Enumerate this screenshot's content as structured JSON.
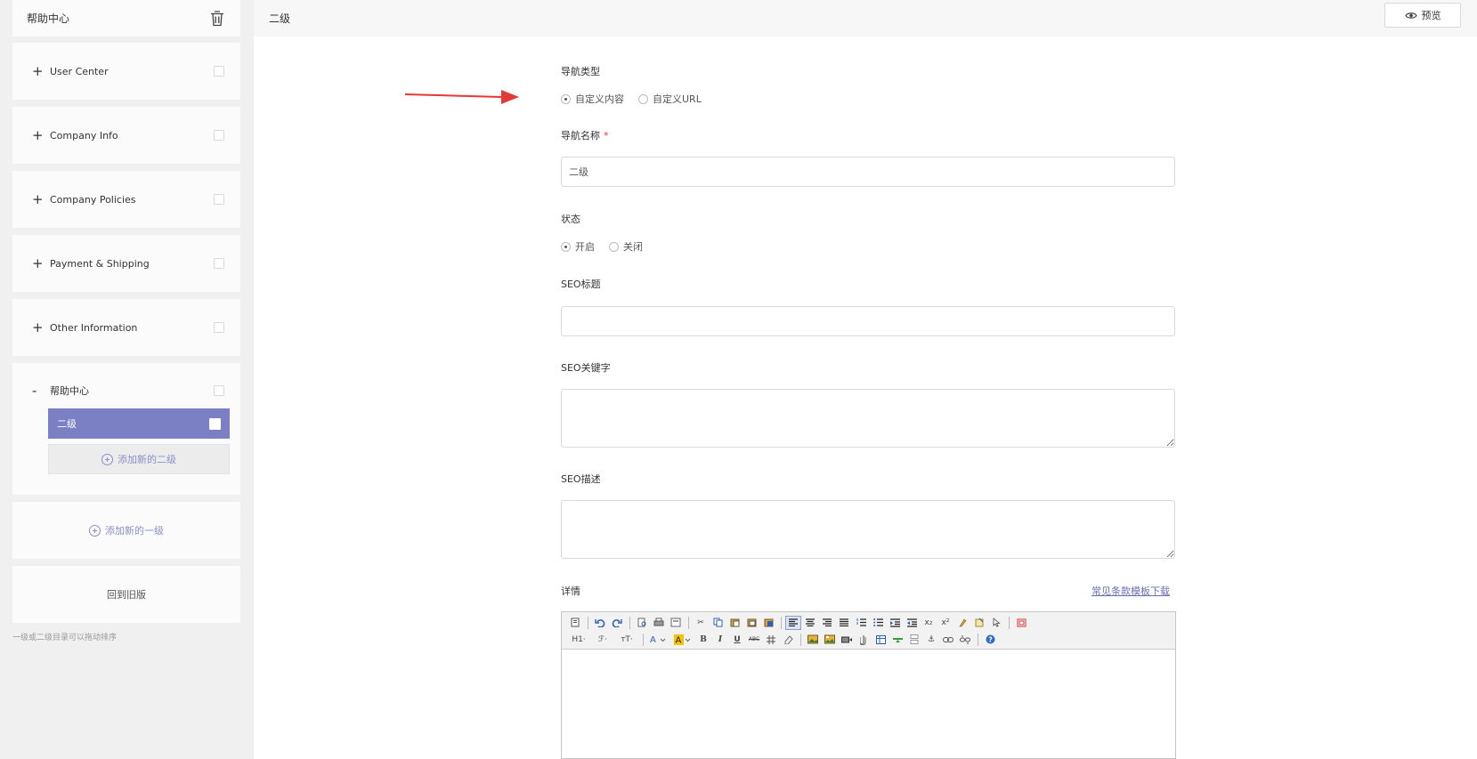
{
  "sidebar": {
    "header_title": "帮助中心",
    "items": [
      {
        "toggle": "+",
        "label": "User Center"
      },
      {
        "toggle": "+",
        "label": "Company Info"
      },
      {
        "toggle": "+",
        "label": "Company Policies"
      },
      {
        "toggle": "+",
        "label": "Payment & Shipping"
      },
      {
        "toggle": "+",
        "label": "Other Information"
      }
    ],
    "expanded": {
      "toggle": "-",
      "label": "帮助中心",
      "active_child": "二级",
      "add_child_label": "添加新的二级"
    },
    "add_top_label": "添加新的一级",
    "back_old_label": "回到旧版",
    "hint": "一级或二级目录可以拖动排序"
  },
  "topbar": {
    "title": "二级",
    "preview_label": "预览"
  },
  "form": {
    "nav_type_label": "导航类型",
    "nav_type_options": [
      "自定义内容",
      "自定义URL"
    ],
    "nav_type_selected": "自定义内容",
    "nav_name_label": "导航名称",
    "nav_name_required": "*",
    "nav_name_value": "二级",
    "status_label": "状态",
    "status_options": [
      "开启",
      "关闭"
    ],
    "status_selected": "开启",
    "seo_title_label": "SEO标题",
    "seo_title_value": "",
    "seo_keywords_label": "SEO关键字",
    "seo_desc_label": "SEO描述",
    "detail_label": "详情",
    "template_link": "常见条款模板下载"
  },
  "editor": {
    "row2_labels": {
      "heading": "H1·",
      "font": "ℱ·",
      "size": "тT·",
      "bold": "B",
      "italic": "I",
      "underline": "U",
      "strike": "ABC"
    }
  },
  "colors": {
    "accent": "#7b7fc4",
    "arrow": "#e53935",
    "link": "#6a6fb5"
  }
}
